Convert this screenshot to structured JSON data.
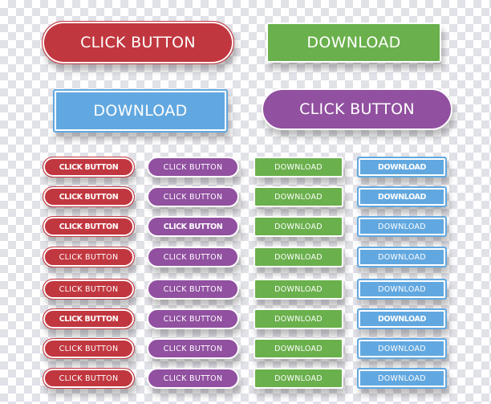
{
  "colors": {
    "red": "#c1373f",
    "purple": "#9150a0",
    "green": "#6ab04c",
    "blue": "#62a8e0"
  },
  "large_buttons": [
    {
      "label": "CLICK BUTTON",
      "color": "red"
    },
    {
      "label": "DOWNLOAD",
      "color": "green"
    },
    {
      "label": "DOWNLOAD",
      "color": "blue"
    },
    {
      "label": "CLICK BUTTON",
      "color": "purple"
    }
  ],
  "small_columns": [
    {
      "color": "red",
      "buttons": [
        {
          "label": "CLICK BUTTON",
          "bold": true
        },
        {
          "label": "CLICK BUTTON",
          "bold": true
        },
        {
          "label": "CLICK BUTTON",
          "bold": true
        },
        {
          "label": "CLICK BUTTON",
          "bold": false
        },
        {
          "label": "CLICK BUTTON",
          "bold": false
        },
        {
          "label": "CLICK BUTTON",
          "bold": true
        },
        {
          "label": "CLICK BUTTON",
          "bold": false
        },
        {
          "label": "CLICK BUTTON",
          "bold": false
        }
      ]
    },
    {
      "color": "purple",
      "buttons": [
        {
          "label": "CLICK BUTTON",
          "bold": false
        },
        {
          "label": "CLICK BUTTON",
          "bold": false
        },
        {
          "label": "CLICK BUTTON",
          "bold": true
        },
        {
          "label": "CLICK BUTTON",
          "bold": false
        },
        {
          "label": "CLICK BUTTON",
          "bold": false
        },
        {
          "label": "CLICK BUTTON",
          "bold": false
        },
        {
          "label": "CLICK BUTTON",
          "bold": false
        },
        {
          "label": "CLICK BUTTON",
          "bold": false
        }
      ]
    },
    {
      "color": "green",
      "buttons": [
        {
          "label": "DOWNLOAD",
          "bold": false
        },
        {
          "label": "DOWNLOAD",
          "bold": false
        },
        {
          "label": "DOWNLOAD",
          "bold": false
        },
        {
          "label": "DOWNLOAD",
          "bold": false
        },
        {
          "label": "DOWNLOAD",
          "bold": false
        },
        {
          "label": "DOWNLOAD",
          "bold": false
        },
        {
          "label": "DOWNLOAD",
          "bold": false
        },
        {
          "label": "DOWNLOAD",
          "bold": false
        }
      ]
    },
    {
      "color": "blue",
      "buttons": [
        {
          "label": "DOWNLOAD",
          "bold": true
        },
        {
          "label": "DOWNLOAD",
          "bold": true
        },
        {
          "label": "DOWNLOAD",
          "bold": false
        },
        {
          "label": "DOWNLOAD",
          "bold": false
        },
        {
          "label": "DOWNLOAD",
          "bold": false
        },
        {
          "label": "DOWNLOAD",
          "bold": true
        },
        {
          "label": "DOWNLOAD",
          "bold": false
        },
        {
          "label": "DOWNLOAD",
          "bold": false
        }
      ]
    }
  ]
}
